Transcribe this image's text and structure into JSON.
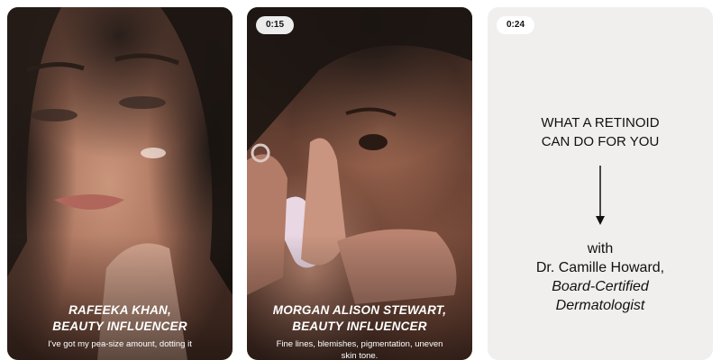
{
  "cards": [
    {
      "caption_line1": "RAFEEKA KHAN,",
      "caption_line2": "BEAUTY INFLUENCER",
      "subtitle": "I've got my pea-size amount, dotting it"
    },
    {
      "timestamp": "0:15",
      "caption_line1": "MORGAN ALISON STEWART,",
      "caption_line2": "BEAUTY INFLUENCER",
      "subtitle_line1": "Fine lines, blemishes, pigmentation, uneven",
      "subtitle_line2": "skin tone."
    },
    {
      "timestamp": "0:24",
      "headline_line1": "WHAT A RETINOID",
      "headline_line2": "CAN DO FOR YOU",
      "with": "with",
      "name": "Dr. Camille Howard,",
      "title_line1": "Board-Certified",
      "title_line2": "Dermatologist"
    }
  ],
  "icons": {
    "arrow": "arrow-down-icon"
  }
}
